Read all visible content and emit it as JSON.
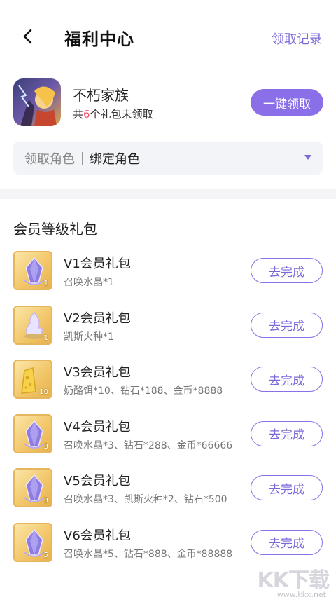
{
  "header": {
    "title": "福利中心",
    "records_link": "领取记录"
  },
  "game": {
    "name": "不朽家族",
    "pending_prefix": "共",
    "pending_count": "6",
    "pending_suffix": "个礼包未领取",
    "claim_all_label": "一键领取",
    "role_label": "领取角色",
    "role_value": "绑定角色"
  },
  "section": {
    "title": "会员等级礼包"
  },
  "gifts": [
    {
      "name": "V1会员礼包",
      "desc": "召唤水晶*1",
      "qty": "1",
      "icon": "purple-crystal-icon",
      "button": "去完成"
    },
    {
      "name": "V2会员礼包",
      "desc": "凯斯火种*1",
      "qty": "1",
      "icon": "fire-seed-icon",
      "button": "去完成"
    },
    {
      "name": "V3会员礼包",
      "desc": "奶酪饵*10、钻石*188、金币*8888",
      "qty": "10",
      "icon": "cheese-bait-icon",
      "button": "去完成"
    },
    {
      "name": "V4会员礼包",
      "desc": "召唤水晶*3、钻石*288、金币*66666",
      "qty": "3",
      "icon": "purple-crystal-icon",
      "button": "去完成"
    },
    {
      "name": "V5会员礼包",
      "desc": "召唤水晶*3、凯斯火种*2、钻石*500",
      "qty": "3",
      "icon": "purple-crystal-icon",
      "button": "去完成"
    },
    {
      "name": "V6会员礼包",
      "desc": "召唤水晶*5、钻石*888、金币*88888",
      "qty": "5",
      "icon": "purple-crystal-icon",
      "button": "去完成"
    }
  ],
  "watermark": {
    "logo": "KK下载",
    "url": "www.kkx.net"
  },
  "colors": {
    "accent": "#8a6fe8",
    "accent_text": "#7a6ad8",
    "highlight": "#ff4d6a"
  }
}
